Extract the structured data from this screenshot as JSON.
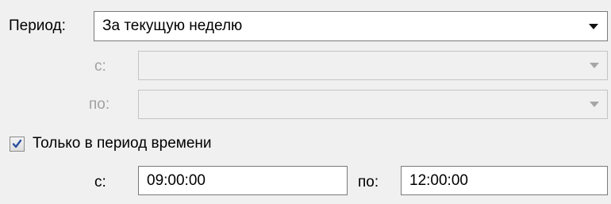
{
  "period": {
    "label": "Период:",
    "selected_value": "За текущую неделю",
    "from_label": "с:",
    "to_label": "по:",
    "from_value": "",
    "to_value": ""
  },
  "time_filter": {
    "checkbox_label": "Только в период времени",
    "checked": true,
    "from_label": "с:",
    "from_value": "09:00:00",
    "to_label": "по:",
    "to_value": "12:00:00"
  },
  "colors": {
    "background": "#f0f0f0",
    "border": "#7a7a7a",
    "disabled_text": "#a0a0a0",
    "checkmark": "#2a4ea0"
  },
  "icons": {
    "dropdown": "chevron-down-icon",
    "check": "checkmark-icon"
  }
}
